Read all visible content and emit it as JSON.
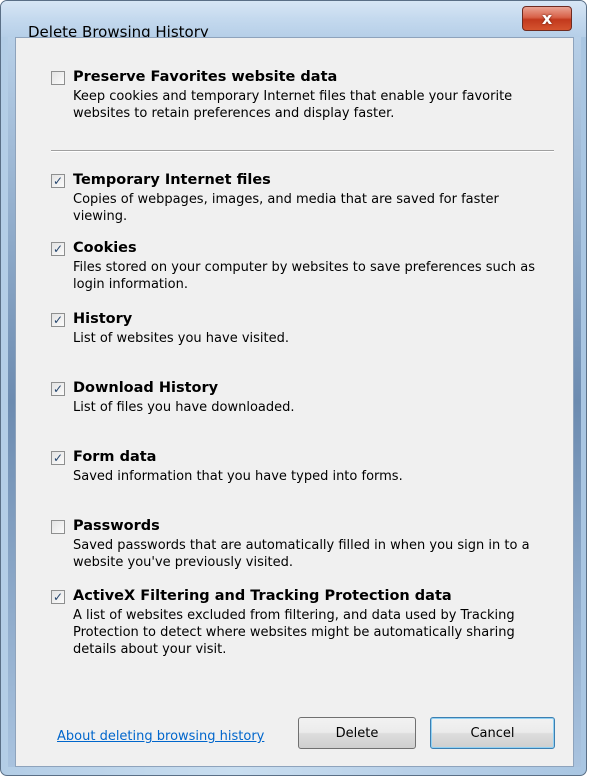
{
  "window": {
    "title": "Delete Browsing History",
    "close_label": "x"
  },
  "options": [
    {
      "label": "Preserve Favorites website data",
      "checked": false,
      "description": "Keep cookies and temporary Internet files that enable your favorite websites to retain preferences and display faster."
    },
    {
      "label": "Temporary Internet files",
      "checked": true,
      "description": "Copies of webpages, images, and media that are saved for faster viewing."
    },
    {
      "label": "Cookies",
      "checked": true,
      "description": "Files stored on your computer by websites to save preferences such as login information."
    },
    {
      "label": "History",
      "checked": true,
      "description": "List of websites you have visited."
    },
    {
      "label": "Download History",
      "checked": true,
      "description": "List of files you have downloaded."
    },
    {
      "label": "Form data",
      "checked": true,
      "description": "Saved information that you have typed into forms."
    },
    {
      "label": "Passwords",
      "checked": false,
      "description": "Saved passwords that are automatically filled in when you sign in to a website you've previously visited."
    },
    {
      "label": "ActiveX Filtering and Tracking Protection data",
      "checked": true,
      "description": "A list of websites excluded from filtering, and data used by Tracking Protection to detect where websites might be automatically sharing details about your visit."
    }
  ],
  "footer": {
    "about_link": "About deleting browsing history",
    "delete_label": "Delete",
    "cancel_label": "Cancel"
  },
  "colors": {
    "link": "#0066cc",
    "check": "#26466d",
    "close_button": "#c2391d"
  }
}
